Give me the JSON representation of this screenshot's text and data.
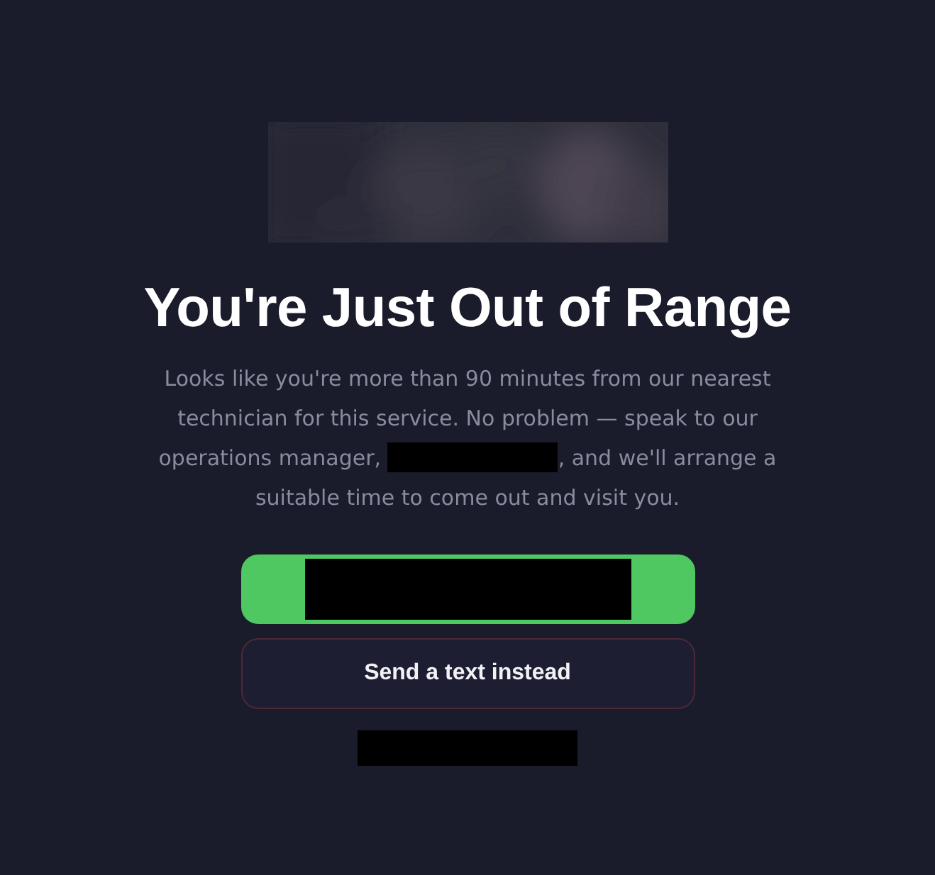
{
  "heading": "You're Just Out of Range",
  "message": {
    "before": "Looks like you're more than 90 minutes from our nearest technician for this service. No problem — speak to our operations manager, ",
    "redacted": true,
    "after": ", and we'll arrange a suitable time to come out and visit you."
  },
  "primary_button": {
    "redacted": true
  },
  "secondary_button": {
    "label": "Send a text instead"
  },
  "footer": {
    "redacted": true
  }
}
